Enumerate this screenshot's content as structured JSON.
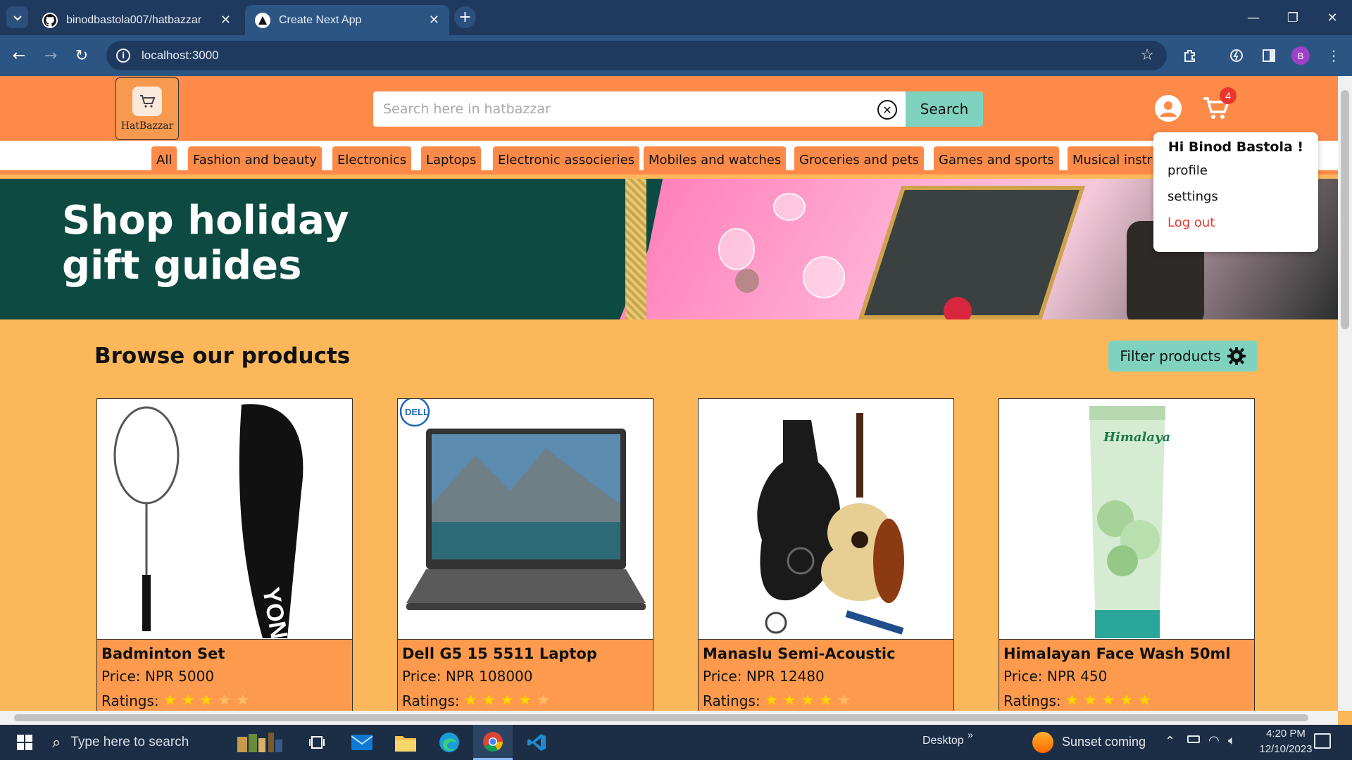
{
  "browser": {
    "tabs": [
      {
        "title": "binodbastola007/hatbazzar",
        "icon": "github-icon"
      },
      {
        "title": "Create Next App",
        "icon": "nextjs-icon"
      }
    ],
    "url": "localhost:3000",
    "profile_initial": "B"
  },
  "header": {
    "logo_text": "HatBazzar",
    "search_placeholder": "Search here in hatbazzar",
    "search_button": "Search",
    "cart_count": "4"
  },
  "categories": [
    "All",
    "Fashion and beauty",
    "Electronics",
    "Laptops",
    "Electronic associeries",
    "Mobiles and watches",
    "Groceries and pets",
    "Games and sports",
    "Musical instruments"
  ],
  "banner": {
    "line1": "Shop holiday",
    "line2": "gift guides"
  },
  "browse": {
    "title": "Browse our products",
    "filter_button": "Filter products"
  },
  "products": [
    {
      "name": "Badminton Set",
      "price": "Price: NPR 5000",
      "ratings_label": "Ratings:",
      "rating": 3
    },
    {
      "name": "Dell G5 15 5511 Laptop",
      "price": "Price: NPR 108000",
      "ratings_label": "Ratings:",
      "rating": 4
    },
    {
      "name": "Manaslu Semi-Acoustic",
      "price": "Price: NPR 12480",
      "ratings_label": "Ratings:",
      "rating": 4
    },
    {
      "name": "Himalayan Face Wash 50ml",
      "price": "Price: NPR 450",
      "ratings_label": "Ratings:",
      "rating": 5
    }
  ],
  "user_menu": {
    "greeting": "Hi Binod Bastola !",
    "profile": "profile",
    "settings": "settings",
    "logout": "Log out"
  },
  "taskbar": {
    "search_placeholder": "Type here to search",
    "desktop_label": "Desktop",
    "weather": "Sunset coming",
    "time": "4:20 PM",
    "date": "12/10/2023"
  },
  "colors": {
    "header": "#fd8a48",
    "page_bg": "#fbb75a",
    "accent_button": "#7fd3be",
    "logout": "#e23a2c"
  }
}
